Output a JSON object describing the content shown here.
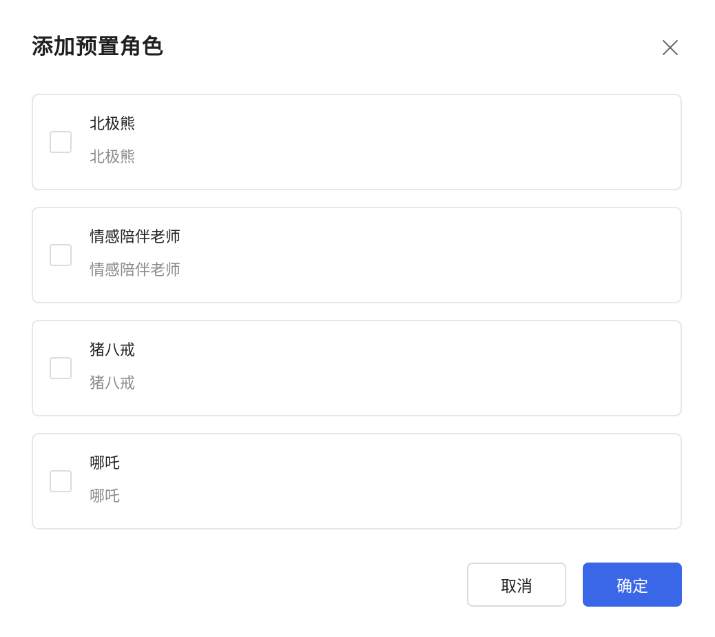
{
  "dialog": {
    "title": "添加预置角色",
    "close_icon": "close-icon"
  },
  "roles": [
    {
      "name": "北极熊",
      "description": "北极熊",
      "checked": false
    },
    {
      "name": "情感陪伴老师",
      "description": "情感陪伴老师",
      "checked": false
    },
    {
      "name": "猪八戒",
      "description": "猪八戒",
      "checked": false
    },
    {
      "name": "哪吒",
      "description": "哪吒",
      "checked": false
    }
  ],
  "footer": {
    "cancel_label": "取消",
    "confirm_label": "确定"
  },
  "colors": {
    "primary": "#3a66e8",
    "border": "#e7e7e9",
    "text": "#1f1f1f",
    "secondary_text": "#8a8a8f"
  }
}
